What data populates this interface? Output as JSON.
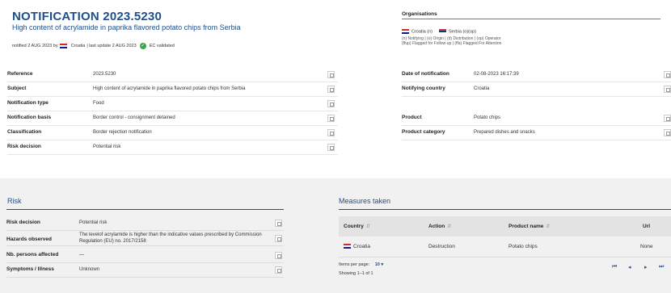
{
  "header": {
    "title": "NOTIFICATION 2023.5230",
    "subtitle": "High content of acrylamide in paprika flavored potato chips from Serbia",
    "notified_prefix": "notified 2 AUG 2023 by",
    "notified_country": "Croatia",
    "last_update": "| last update 2 AUG 2023",
    "validated": "EC validated"
  },
  "organisations": {
    "title": "Organisations",
    "items": [
      {
        "country": "Croatia",
        "code": "(n)",
        "flag": "hr"
      },
      {
        "country": "Serbia",
        "code": "(o)(op)",
        "flag": "rs"
      }
    ],
    "legend_1": "(n) Notifying | (o) Origin | (d) Distribution | (op) Operator",
    "legend_2": "(ffup) Flagged for Follow-up | (ffa) Flagged For Attention"
  },
  "details_left": [
    {
      "label": "Reference",
      "value": "2023.5230"
    },
    {
      "label": "Subject",
      "value": "High content of acrylamide in paprika flavored potato chips from Serbia"
    },
    {
      "label": "Notification type",
      "value": "Food"
    },
    {
      "label": "Notification basis",
      "value": "Border control - consignment detained"
    },
    {
      "label": "Classification",
      "value": "Border rejection notification"
    },
    {
      "label": "Risk decision",
      "value": "Potential risk"
    }
  ],
  "details_right": [
    {
      "label": "Date of notification",
      "value": "02-08-2023 16:17:39"
    },
    {
      "label": "Notifying country",
      "value": "Croatia"
    },
    {
      "label": "Product",
      "value": "Potato chips"
    },
    {
      "label": "Product category",
      "value": "Prepared dishes and snacks"
    }
  ],
  "risk": {
    "title": "Risk",
    "rows": [
      {
        "label": "Risk decision",
        "value": "Potential risk"
      },
      {
        "label": "Hazards observed",
        "value": "The levelof acrylamide is higher than the indicative values prescribed by Commission Regulation (EU) no. 2017/2158"
      },
      {
        "label": "Nb. persons affected",
        "value": "—"
      },
      {
        "label": "Symptoms / Illness",
        "value": "Unknown"
      }
    ]
  },
  "measures": {
    "title": "Measures taken",
    "columns": [
      "Country",
      "Action",
      "Product name",
      "Url"
    ],
    "rows": [
      {
        "country": "Croatia",
        "action": "Destruction",
        "product": "Potato chips",
        "url": "None"
      }
    ],
    "items_per_page_label": "Items per page:",
    "items_per_page": "10",
    "showing": "Showing 1–1 of 1"
  },
  "colors": {
    "accent": "#1f4e8c",
    "panel": "#f1f1f1",
    "ok": "#3aa54a"
  }
}
